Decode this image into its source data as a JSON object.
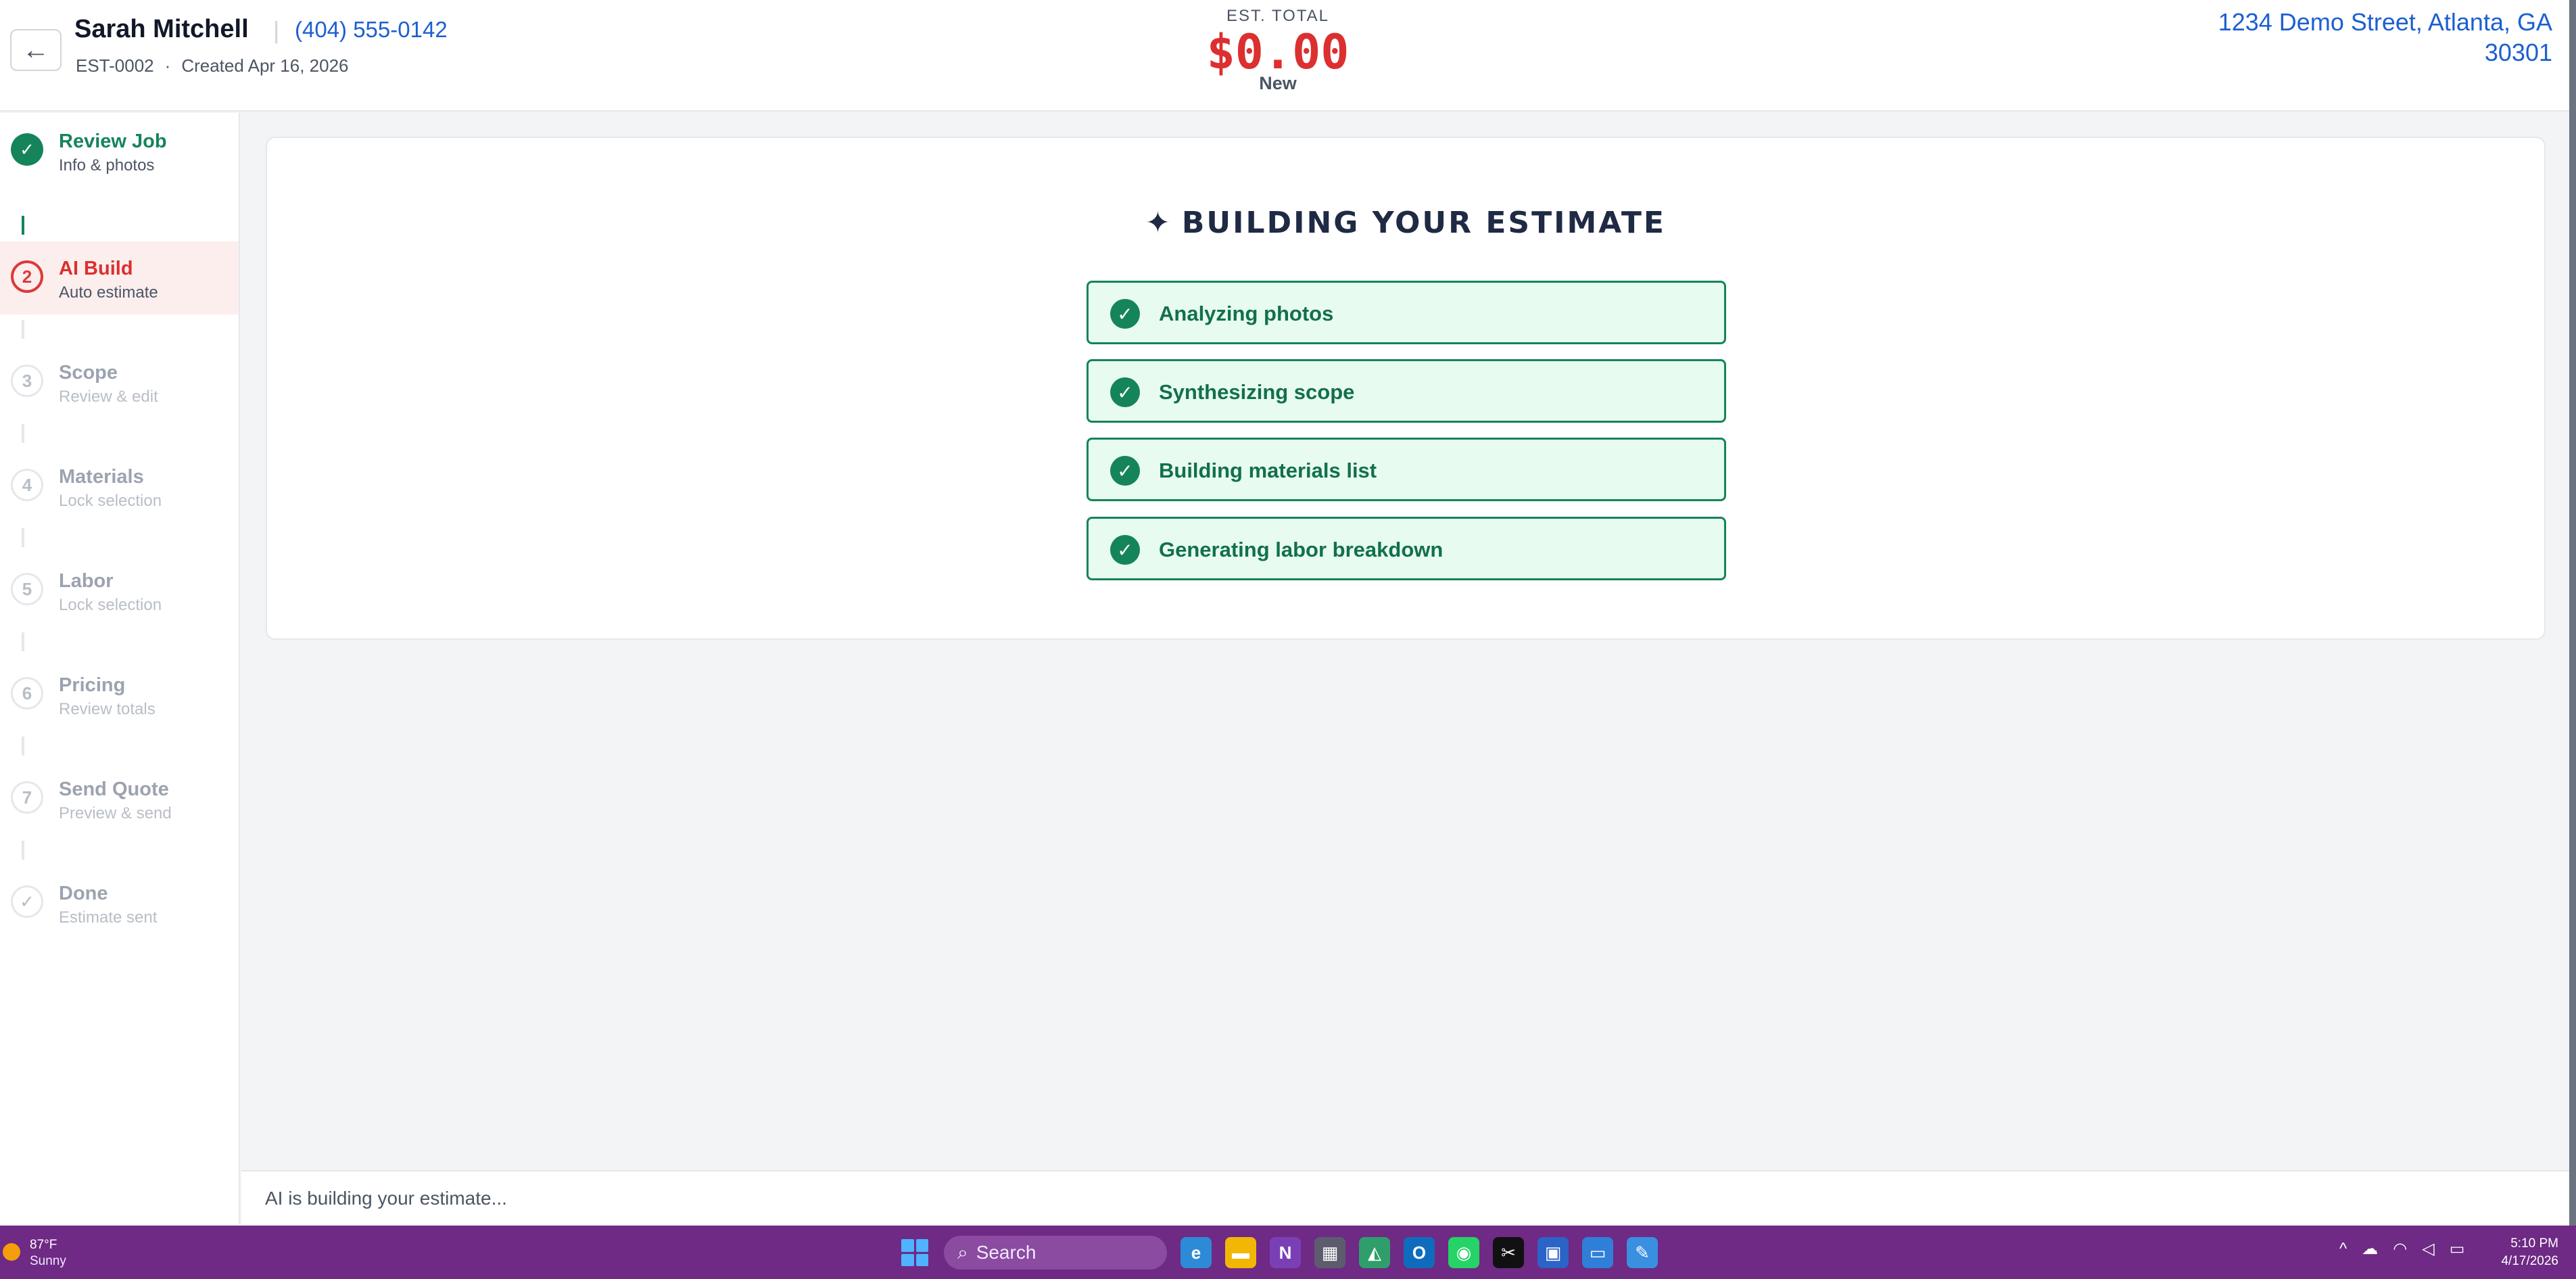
{
  "header": {
    "back_icon": "←",
    "customer_name": "Sarah Mitchell",
    "separator": "|",
    "phone": "(404) 555-0142",
    "estimate_id": "EST-0002",
    "meta_dot": "·",
    "created": "Created Apr 16, 2026",
    "total_label": "EST. TOTAL",
    "total_value": "$0.00",
    "status": "New",
    "address_line1": "1234 Demo Street, Atlanta, GA",
    "address_line2": "30301"
  },
  "steps": [
    {
      "number": "✓",
      "title": "Review Job",
      "subtitle": "Info & photos",
      "state": "done"
    },
    {
      "number": "2",
      "title": "AI Build",
      "subtitle": "Auto estimate",
      "state": "active"
    },
    {
      "number": "3",
      "title": "Scope",
      "subtitle": "Review & edit",
      "state": "pending"
    },
    {
      "number": "4",
      "title": "Materials",
      "subtitle": "Lock selection",
      "state": "pending"
    },
    {
      "number": "5",
      "title": "Labor",
      "subtitle": "Lock selection",
      "state": "pending"
    },
    {
      "number": "6",
      "title": "Pricing",
      "subtitle": "Review totals",
      "state": "pending"
    },
    {
      "number": "7",
      "title": "Send Quote",
      "subtitle": "Preview & send",
      "state": "pending"
    },
    {
      "number": "✓",
      "title": "Done",
      "subtitle": "Estimate sent",
      "state": "pending"
    }
  ],
  "build": {
    "sparkle": "✦",
    "title": "BUILDING YOUR ESTIMATE",
    "tasks": [
      {
        "check": "✓",
        "label": "Analyzing photos"
      },
      {
        "check": "✓",
        "label": "Synthesizing scope"
      },
      {
        "check": "✓",
        "label": "Building materials list"
      },
      {
        "check": "✓",
        "label": "Generating labor breakdown"
      }
    ]
  },
  "status_bar": {
    "text": "AI is building your estimate..."
  },
  "taskbar": {
    "weather_temp": "87°F",
    "weather_desc": "Sunny",
    "search_placeholder": "Search",
    "search_icon": "⌕",
    "time": "5:10 PM",
    "date": "4/17/2026",
    "tray_chevron": "^",
    "apps": [
      {
        "name": "edge",
        "glyph": "e",
        "color": "#2d8ad6"
      },
      {
        "name": "file-explorer",
        "glyph": "▬",
        "color": "#f2b705"
      },
      {
        "name": "onenote",
        "glyph": "N",
        "color": "#7b3fb5"
      },
      {
        "name": "calculator",
        "glyph": "▦",
        "color": "#5c5c6e"
      },
      {
        "name": "photos",
        "glyph": "◭",
        "color": "#2f9e6a"
      },
      {
        "name": "outlook",
        "glyph": "O",
        "color": "#0f6cbd"
      },
      {
        "name": "whatsapp",
        "glyph": "◉",
        "color": "#25d366"
      },
      {
        "name": "capcut",
        "glyph": "✂",
        "color": "#111111"
      },
      {
        "name": "store",
        "glyph": "▣",
        "color": "#2b63c6"
      },
      {
        "name": "remote-desktop",
        "glyph": "▭",
        "color": "#2f7fd8"
      },
      {
        "name": "paint",
        "glyph": "✎",
        "color": "#3a8fe0"
      }
    ]
  },
  "colors": {
    "accent_green": "#15845a",
    "accent_red": "#dc2f2f",
    "link_blue": "#1d5fd1",
    "taskbar": "#6e2a84"
  }
}
